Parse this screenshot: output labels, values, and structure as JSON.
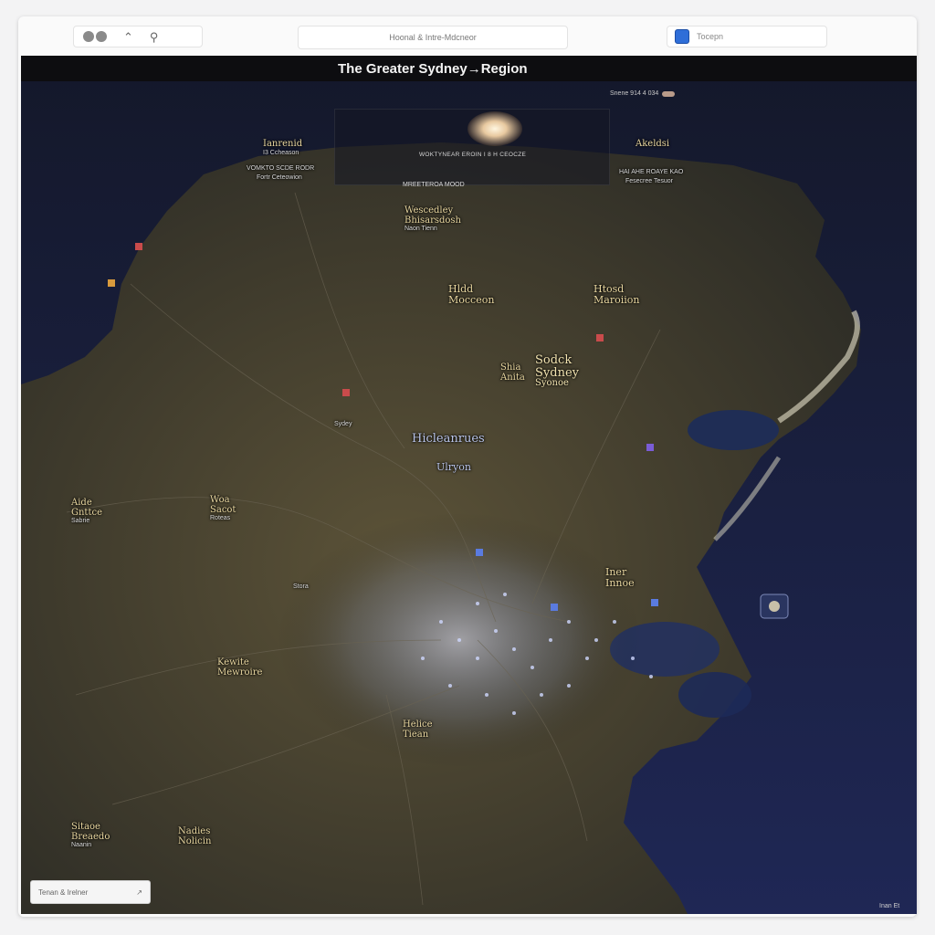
{
  "toolbar": {
    "center_text": "Hoonal & Intre-Mdcneor",
    "right_text": "Tocepn"
  },
  "map": {
    "title": "The Greater Sydney→Region",
    "top_right_text": "Snene 914 4 034",
    "panel_text": "WOKTYNEAR EROIN I 8 H CEOCZE",
    "panel_subtext": "MREETEROA MOOD",
    "search_placeholder": "Tenan & Irelner",
    "scale_note": "Inan Et",
    "labels": {
      "north_west": "Ianrenid",
      "north_west_sub": "I3 Ccheason",
      "north_west_desc": "VOMKTO SCDE RODR",
      "north_west_desc2": "Fortr Ceteowion",
      "north_east": "Akeldsi",
      "north_east_desc": "HAI AHE ROAYE KAO",
      "north_east_desc2": "Fesecree Tesuor",
      "upper_mid": "Wescedley",
      "upper_mid2": "Bhisarsdosh",
      "upper_mid3": "Naon Tienn",
      "center_west": "Hldd",
      "center_west2": "Mocceon",
      "center_east": "Htosd",
      "center_east2": "Maroiion",
      "center_main1": "Sodck",
      "center_main2": "Sydney",
      "center_main3": "Syonoe",
      "center_side": "Shia",
      "center_side2": "Anita",
      "mid_region": "Hicleanrues",
      "mid_region2": "Ulryon",
      "left_mid": "Aide",
      "left_mid2": "Gnttce",
      "left_mid3": "Sabrie",
      "left_mid_b": "Woa",
      "left_mid_b2": "Sacot",
      "left_mid_b3": "Roteas",
      "inner": "Iner",
      "inner2": "Innoe",
      "kewite": "Kewite",
      "kewite2": "Mewroire",
      "nadies": "Nadies",
      "nadies2": "Nolicin",
      "south_west": "Sitaoe",
      "south_west2": "Breaedo",
      "south_west3": "Naanin",
      "south_mid": "Helice",
      "south_mid2": "Tiean",
      "small_a": "Sydey",
      "small_b": "Stora"
    }
  },
  "colors": {
    "ocean": "#1b2146",
    "land": "#3e3a2c",
    "city": "#c9d3ff",
    "label": "#e9d7a0"
  }
}
